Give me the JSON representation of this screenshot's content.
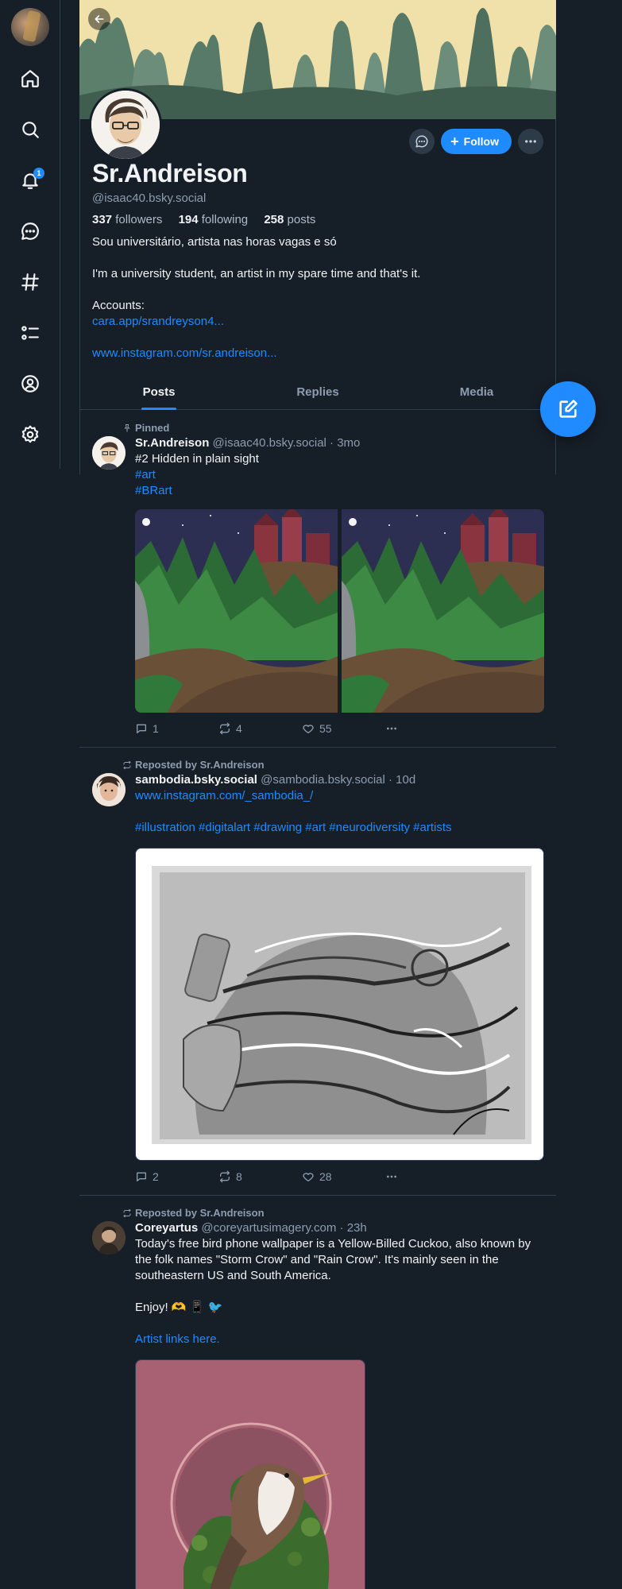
{
  "nav": {
    "notifications_badge": "1",
    "icons": [
      "home-icon",
      "search-icon",
      "bell-icon",
      "chat-icon",
      "hashtag-icon",
      "list-icon",
      "profile-icon",
      "settings-icon"
    ]
  },
  "profile": {
    "display_name": "Sr.Andreison",
    "handle": "@isaac40.bsky.social",
    "followers_count": "337",
    "followers_label": "followers",
    "following_count": "194",
    "following_label": "following",
    "posts_count": "258",
    "posts_label": "posts",
    "follow_label": "Follow",
    "bio_line1": "Sou universitário, artista nas horas vagas e só",
    "bio_line2": "I'm a university student, an artist in my spare time and that's it.",
    "bio_accounts": "Accounts:",
    "bio_link1": "cara.app/srandreyson4...",
    "bio_link2": "www.instagram.com/sr.andreison..."
  },
  "tabs": [
    {
      "label": "Posts",
      "active": true
    },
    {
      "label": "Replies",
      "active": false
    },
    {
      "label": "Media",
      "active": false
    }
  ],
  "posts": [
    {
      "context": "Pinned",
      "author_name": "Sr.Andreison",
      "author_handle": "@isaac40.bsky.social",
      "time": "· 3mo",
      "text": "#2 Hidden in plain sight",
      "tag1": "#art",
      "tag2": "#BRart",
      "replies": "1",
      "reposts": "4",
      "likes": "55"
    },
    {
      "context": "Reposted by Sr.Andreison",
      "author_name": "sambodia.bsky.social",
      "author_handle": "@sambodia.bsky.social",
      "time": "· 10d",
      "link": "www.instagram.com/_sambodia_/",
      "tags": "#illustration #digitalart #drawing #art #neurodiversity #artists",
      "replies": "2",
      "reposts": "8",
      "likes": "28"
    },
    {
      "context": "Reposted by Sr.Andreison",
      "author_name": "Coreyartus",
      "author_handle": "@coreyartusimagery.com",
      "time": "· 23h",
      "text": "Today's free bird phone wallpaper is a Yellow-Billed Cuckoo, also known by the folk names \"Storm Crow\" and \"Rain Crow\". It's mainly seen in the southeastern US and South America.",
      "enjoy": "Enjoy!  🫶 📱 🐦",
      "link": "Artist links here."
    }
  ],
  "colors": {
    "background": "#161e27",
    "accent": "#208bfe",
    "border": "#2e4052",
    "muted_text": "#8d9db0"
  }
}
